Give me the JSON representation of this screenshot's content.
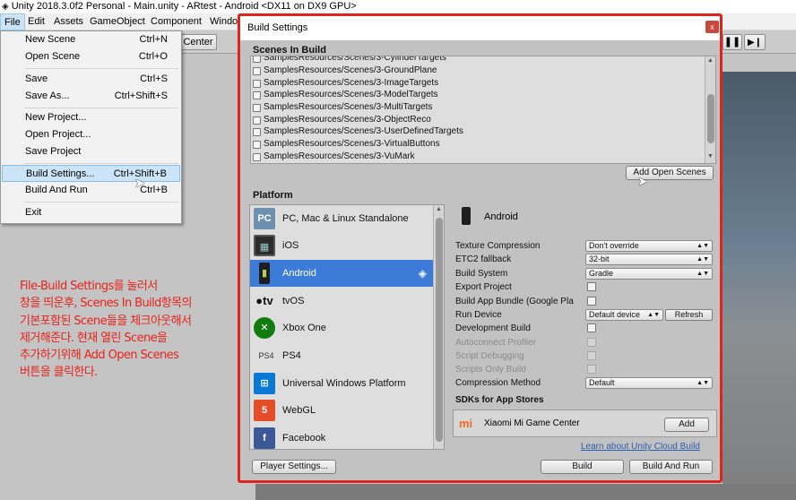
{
  "window": {
    "title": "Unity 2018.3.0f2 Personal - Main.unity - ARtest - Android <DX11 on DX9 GPU>",
    "icon": "unity-logo-icon"
  },
  "menubar": [
    "File",
    "Edit",
    "Assets",
    "GameObject",
    "Component",
    "Windo"
  ],
  "toolbar": {
    "center_label": "Center"
  },
  "file_menu": {
    "items": [
      {
        "label": "New Scene",
        "shortcut": "Ctrl+N"
      },
      {
        "label": "Open Scene",
        "shortcut": "Ctrl+O"
      },
      {
        "label": "Save",
        "shortcut": "Ctrl+S"
      },
      {
        "label": "Save As...",
        "shortcut": "Ctrl+Shift+S"
      },
      {
        "label": "New Project...",
        "shortcut": ""
      },
      {
        "label": "Open Project...",
        "shortcut": ""
      },
      {
        "label": "Save Project",
        "shortcut": ""
      },
      {
        "label": "Build Settings...",
        "shortcut": "Ctrl+Shift+B"
      },
      {
        "label": "Build And Run",
        "shortcut": "Ctrl+B"
      },
      {
        "label": "Exit",
        "shortcut": ""
      }
    ],
    "highlighted": "Build Settings..."
  },
  "dialog": {
    "title": "Build Settings",
    "close_glyph": "x",
    "scenes_title": "Scenes In Build",
    "scenes": [
      "SamplesResources/Scenes/3-CylinderTargets",
      "SamplesResources/Scenes/3-GroundPlane",
      "SamplesResources/Scenes/3-ImageTargets",
      "SamplesResources/Scenes/3-ModelTargets",
      "SamplesResources/Scenes/3-MultiTargets",
      "SamplesResources/Scenes/3-ObjectReco",
      "SamplesResources/Scenes/3-UserDefinedTargets",
      "SamplesResources/Scenes/3-VirtualButtons",
      "SamplesResources/Scenes/3-VuMark"
    ],
    "add_open_scenes": "Add Open Scenes",
    "platform_title": "Platform",
    "platforms": [
      {
        "label": "PC, Mac & Linux Standalone",
        "icon": "standalone-icon"
      },
      {
        "label": "iOS",
        "icon": "ipad-icon"
      },
      {
        "label": "Android",
        "icon": "android-phone-icon",
        "selected": true
      },
      {
        "label": "tvOS",
        "icon": "appletv-icon"
      },
      {
        "label": "Xbox One",
        "icon": "xbox-icon"
      },
      {
        "label": "PS4",
        "icon": "ps4-icon"
      },
      {
        "label": "Universal Windows Platform",
        "icon": "windows-icon"
      },
      {
        "label": "WebGL",
        "icon": "html5-icon"
      },
      {
        "label": "Facebook",
        "icon": "facebook-icon"
      }
    ],
    "selected_platform": "Android",
    "settings": {
      "texture_compression": {
        "label": "Texture Compression",
        "value": "Don't override"
      },
      "etc2_fallback": {
        "label": "ETC2 fallback",
        "value": "32-bit"
      },
      "build_system": {
        "label": "Build System",
        "value": "Gradle"
      },
      "export_project": {
        "label": "Export Project"
      },
      "build_app_bundle": {
        "label": "Build App Bundle (Google Pla"
      },
      "run_device": {
        "label": "Run Device",
        "value": "Default device",
        "refresh": "Refresh"
      },
      "development_build": {
        "label": "Development Build"
      },
      "autoconnect_profiler": {
        "label": "Autoconnect Profiler"
      },
      "script_debugging": {
        "label": "Script Debugging"
      },
      "scripts_only_build": {
        "label": "Scripts Only Build"
      },
      "compression_method": {
        "label": "Compression Method",
        "value": "Default"
      }
    },
    "sdks_title": "SDKs for App Stores",
    "sdk": {
      "label": "Xiaomi Mi Game Center",
      "add": "Add"
    },
    "cloud_link": "Learn about Unity Cloud Build",
    "player_settings": "Player Settings...",
    "build": "Build",
    "build_and_run": "Build And Run",
    "border_color": "#e0231b"
  },
  "annotation": {
    "lines": [
      "File-Build Settings를 눌러서",
      "창을 띄운후,  Scenes  In Build항목의",
      "기본포함된 Scene들을 체크아웃해서",
      "제거해준다.   현재 열린 Scene을",
      "추가하기위해  Add Open Scenes",
      "버튼을 클릭한다."
    ],
    "color": "#e8231b"
  }
}
